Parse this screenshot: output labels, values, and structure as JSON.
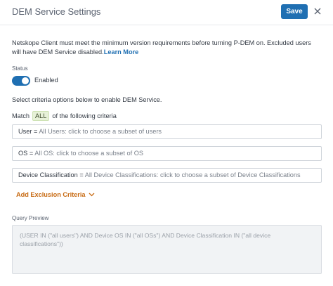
{
  "header": {
    "title": "DEM Service Settings",
    "save_label": "Save",
    "close_icon": "close-icon"
  },
  "description": {
    "text": "Netskope Client must meet the minimum version requirements before turning P-DEM on. Excluded users will have DEM Service disabled.",
    "link_label": "Learn More"
  },
  "status": {
    "label": "Status",
    "toggle_on": true,
    "toggle_text": "Enabled",
    "accent_color": "#1f6fb2"
  },
  "criteria": {
    "help_text": "Select criteria options below to enable DEM Service.",
    "match_prefix": "Match",
    "match_value": "ALL",
    "match_suffix": "of the following criteria",
    "items": [
      {
        "field": "User = ",
        "hint": "All Users: click to choose a subset of users"
      },
      {
        "field": "OS = ",
        "hint": "All OS: click to choose a subset of OS"
      },
      {
        "field": "Device Classification = ",
        "hint": "All Device Classifications: click to choose a subset of Device Classifications"
      }
    ],
    "add_exclusion_label": "Add Exclusion Criteria",
    "add_exclusion_color": "#c76a12"
  },
  "query_preview": {
    "label": "Query Preview",
    "text": "(USER IN (\"all users\") AND Device OS IN (\"all OSs\") AND Device Classification IN (\"all device classifications\"))"
  }
}
